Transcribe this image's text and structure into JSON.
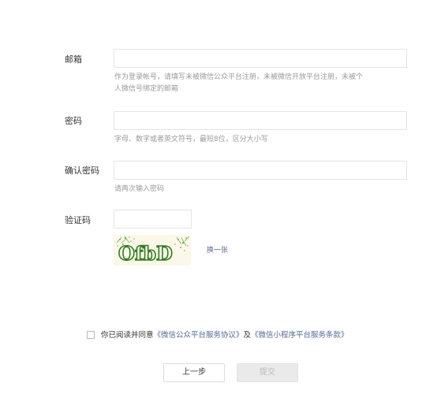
{
  "form": {
    "email": {
      "label": "邮箱",
      "value": "",
      "hint_line1": "作为登录帐号，请填写未被微信公众平台注册，未被微信开放平台注册，未被个",
      "hint_line2": "人微信号绑定的邮箱"
    },
    "password": {
      "label": "密码",
      "value": "",
      "hint": "字母、数字或者英文符号，最短8位，区分大小写"
    },
    "confirm_password": {
      "label": "确认密码",
      "value": "",
      "hint": "请再次输入密码"
    },
    "captcha": {
      "label": "验证码",
      "value": "",
      "image_text": "OfbD",
      "refresh_label": "换一张"
    }
  },
  "agreement": {
    "prefix": "你已阅读并同意",
    "link1": "《微信公众平台服务协议》",
    "conjunction": "及",
    "link2": "《微信小程序平台服务条款》",
    "checked": false
  },
  "buttons": {
    "prev_label": "上一步",
    "submit_label": "提交"
  },
  "colors": {
    "link": "#576b95",
    "hint": "#9a9a9a",
    "border": "#e4e4e4",
    "disabled_bg": "#eaeaea"
  }
}
